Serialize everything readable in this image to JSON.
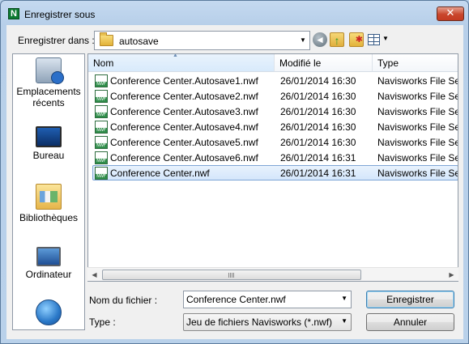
{
  "window": {
    "title": "Enregistrer sous",
    "app_icon_letter": "N",
    "close_glyph": "✕"
  },
  "toolbar": {
    "save_in_label": "Enregistrer dans :",
    "location": "autosave",
    "dropdown_glyph": "▼",
    "icons": [
      "back-icon",
      "up-folder-icon",
      "new-folder-icon",
      "views-menu-icon"
    ]
  },
  "places": [
    {
      "label": "Emplacements récents",
      "icon": "recent-places-icon"
    },
    {
      "label": "Bureau",
      "icon": "desktop-icon"
    },
    {
      "label": "Bibliothèques",
      "icon": "libraries-icon"
    },
    {
      "label": "Ordinateur",
      "icon": "computer-icon"
    },
    {
      "label": "",
      "icon": "network-icon"
    }
  ],
  "columns": {
    "name": "Nom",
    "modified": "Modifié le",
    "type": "Type"
  },
  "files": [
    {
      "name": "Conference Center.Autosave1.nwf",
      "modified": "26/01/2014 16:30",
      "type": "Navisworks File Set"
    },
    {
      "name": "Conference Center.Autosave2.nwf",
      "modified": "26/01/2014 16:30",
      "type": "Navisworks File Set"
    },
    {
      "name": "Conference Center.Autosave3.nwf",
      "modified": "26/01/2014 16:30",
      "type": "Navisworks File Set"
    },
    {
      "name": "Conference Center.Autosave4.nwf",
      "modified": "26/01/2014 16:30",
      "type": "Navisworks File Set"
    },
    {
      "name": "Conference Center.Autosave5.nwf",
      "modified": "26/01/2014 16:30",
      "type": "Navisworks File Set"
    },
    {
      "name": "Conference Center.Autosave6.nwf",
      "modified": "26/01/2014 16:31",
      "type": "Navisworks File Set"
    },
    {
      "name": "Conference Center.nwf",
      "modified": "26/01/2014 16:31",
      "type": "Navisworks File Set",
      "selected": true
    }
  ],
  "form": {
    "filename_label": "Nom du fichier :",
    "filename_value": "Conference Center.nwf",
    "type_label": "Type :",
    "type_value": "Jeu de fichiers Navisworks (*.nwf)"
  },
  "buttons": {
    "save": "Enregistrer",
    "cancel": "Annuler"
  },
  "colors": {
    "selection_border": "#7fa6d6",
    "default_button_border": "#3c7fb1",
    "close_red": "#c43b22"
  }
}
